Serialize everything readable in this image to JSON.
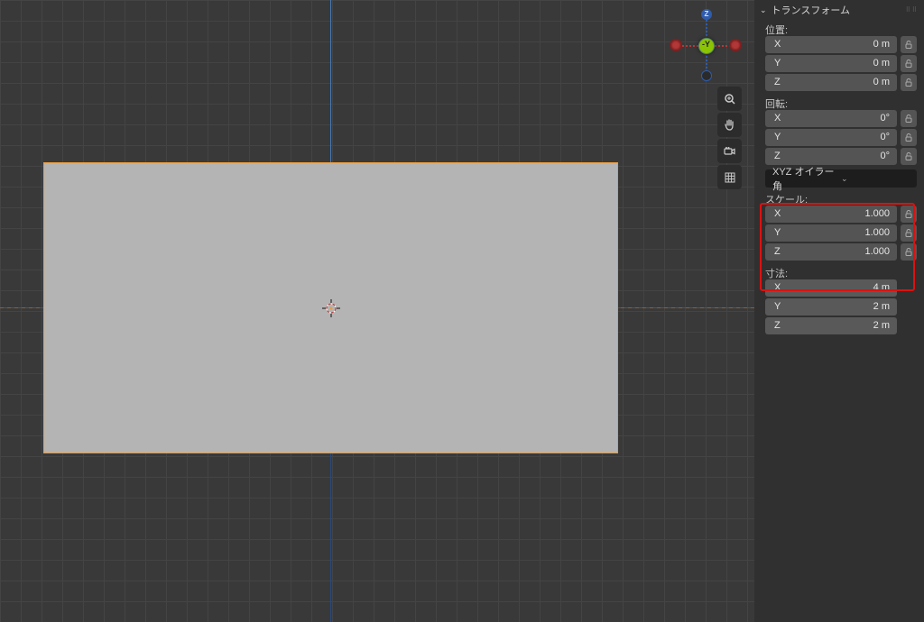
{
  "panel": {
    "title": "トランスフォーム",
    "location": {
      "label": "位置:",
      "x": {
        "axis": "X",
        "value": "0 m"
      },
      "y": {
        "axis": "Y",
        "value": "0 m"
      },
      "z": {
        "axis": "Z",
        "value": "0 m"
      }
    },
    "rotation": {
      "label": "回転:",
      "x": {
        "axis": "X",
        "value": "0°"
      },
      "y": {
        "axis": "Y",
        "value": "0°"
      },
      "z": {
        "axis": "Z",
        "value": "0°"
      }
    },
    "rotation_mode": "XYZ オイラー角",
    "scale": {
      "label": "スケール:",
      "x": {
        "axis": "X",
        "value": "1.000"
      },
      "y": {
        "axis": "Y",
        "value": "1.000"
      },
      "z": {
        "axis": "Z",
        "value": "1.000"
      }
    },
    "dimensions": {
      "label": "寸法:",
      "x": {
        "axis": "X",
        "value": "4 m"
      },
      "y": {
        "axis": "Y",
        "value": "2 m"
      },
      "z": {
        "axis": "Z",
        "value": "2 m"
      }
    }
  },
  "gizmo": {
    "z": "Z",
    "y": "-Y"
  }
}
